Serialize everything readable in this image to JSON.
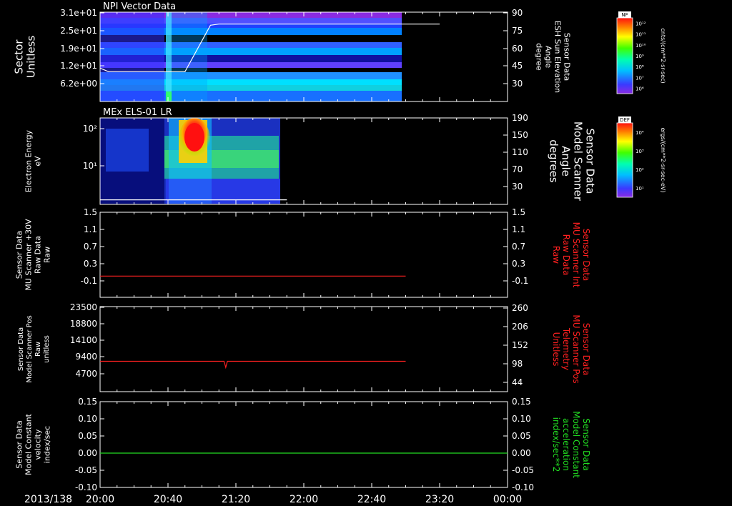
{
  "colors": {
    "background": "#000000",
    "axis": "#ffffff",
    "red": "#ff2020",
    "green": "#22dd22"
  },
  "time_axis": {
    "date_label": "2013/138",
    "ticks": [
      "20:00",
      "20:40",
      "21:20",
      "22:00",
      "22:40",
      "23:20",
      "00:00"
    ]
  },
  "colorbars": [
    {
      "name": "NF",
      "unit": "cnts/(cm**2-sr-sec)",
      "tick_labels": [
        "10¹²",
        "10¹¹",
        "10¹⁰",
        "10⁹",
        "10⁸",
        "10⁷",
        "10⁶"
      ]
    },
    {
      "name": "DEF",
      "unit": "ergs/(cm**2-sr-sec-eV)",
      "tick_labels": [
        "10⁴",
        "10³",
        "10²",
        "10¹"
      ]
    }
  ],
  "chart_data": [
    {
      "type": "heatmap",
      "title": "NPI Vector Data",
      "ylabel": [
        "Sector",
        "Unitless"
      ],
      "y_tick_labels": [
        "3.1e+01",
        "2.5e+01",
        "1.9e+01",
        "1.2e+01",
        "6.2e+00"
      ],
      "right_ylabel": [
        "Sensor Data",
        "ESH Sun Elevation",
        "Angle",
        "degree"
      ],
      "right_ticks": [
        "90",
        "75",
        "60",
        "45",
        "30"
      ],
      "right_ylim": [
        15,
        90
      ],
      "data_end": "23:00",
      "overlay_line": {
        "name": "ESH Sun Elevation Angle",
        "x": [
          "20:00",
          "20:05",
          "20:40",
          "20:50",
          "21:05",
          "21:10",
          "23:20"
        ],
        "y": [
          43,
          40,
          40,
          40,
          79,
          80,
          80
        ]
      }
    },
    {
      "type": "heatmap",
      "title": "MEx ELS-01 LR",
      "ylabel": [
        "Electron Energy",
        "eV"
      ],
      "y_tick_labels": [
        "10²",
        "10¹"
      ],
      "right_ylabel": [
        "Sensor Data",
        "Model Scanner",
        "Angle",
        "degrees"
      ],
      "right_ticks": [
        "190",
        "150",
        "110",
        "70",
        "30"
      ],
      "right_ylim": [
        0,
        190
      ],
      "data_end": "21:50",
      "overlay_line": {
        "name": "Model Scanner Angle",
        "x": [
          "20:00",
          "21:50"
        ],
        "y": [
          10,
          10
        ]
      }
    },
    {
      "type": "line",
      "ylabel": [
        "Sensor Data",
        "MU Scanner +30V",
        "Raw Data",
        "Raw"
      ],
      "yticks": [
        "1.5",
        "1.1",
        "0.7",
        "0.3",
        "-0.1"
      ],
      "ylim": [
        -0.5,
        1.5
      ],
      "right_ylabel": [
        "Sensor Data",
        "MU Scanner Int",
        "Raw Data",
        "Raw"
      ],
      "right_ticks": [
        "1.5",
        "1.1",
        "0.7",
        "0.3",
        "-0.1"
      ],
      "series": [
        {
          "color": "#ff2020",
          "x": [
            "20:00",
            "23:00"
          ],
          "y": [
            0.0,
            0.0
          ]
        }
      ]
    },
    {
      "type": "line",
      "ylabel": [
        "Sensor Data",
        "Model Scanner Pos",
        "Raw",
        "unitless"
      ],
      "yticks": [
        "23500",
        "18800",
        "14100",
        "9400",
        "4700"
      ],
      "ylim": [
        0,
        23500
      ],
      "right_ylabel": [
        "Sensor Data",
        "MU Scanner Pos",
        "Telemetry",
        "Unitless"
      ],
      "right_ticks": [
        "260",
        "206",
        "152",
        "98",
        "44"
      ],
      "series": [
        {
          "color": "#ff2020",
          "x": [
            "20:00",
            "21:13",
            "21:14",
            "21:15",
            "23:00"
          ],
          "y": [
            8400,
            8400,
            6700,
            8400,
            8400
          ]
        }
      ]
    },
    {
      "type": "line",
      "ylabel": [
        "Sensor Data",
        "Model Constant",
        "velocity",
        "index/sec"
      ],
      "yticks": [
        "0.15",
        "0.10",
        "0.05",
        "0.00",
        "-0.05",
        "-0.10"
      ],
      "ylim": [
        -0.1,
        0.15
      ],
      "right_ylabel": [
        "Sensor Data",
        "Model Constant",
        "acceleration",
        "index/sec**2"
      ],
      "right_ticks": [
        "0.15",
        "0.10",
        "0.05",
        "0.00",
        "-0.05",
        "-0.10"
      ],
      "series": [
        {
          "color": "#22dd22",
          "x": [
            "20:00",
            "00:00"
          ],
          "y": [
            0.0,
            0.0
          ]
        }
      ]
    }
  ]
}
